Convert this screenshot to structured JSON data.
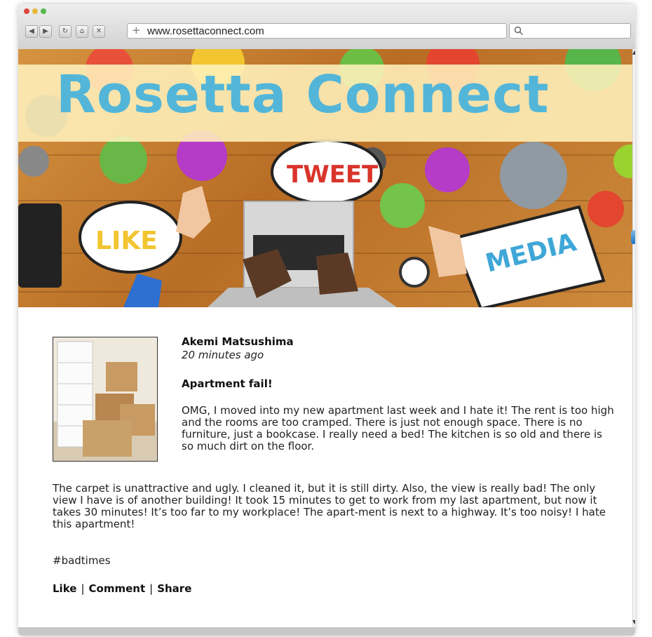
{
  "browser": {
    "url": "www.rosettaconnect.com",
    "search_icon": "magnifier-icon",
    "nav_icons": [
      "back-icon",
      "forward-icon",
      "reload-icon",
      "home-icon",
      "close-icon",
      "plus-icon"
    ]
  },
  "hero": {
    "site_title": "Rosetta Connect",
    "bubble_like": "LIKE",
    "bubble_tweet": "TWEET",
    "bubble_media": "MEDIA",
    "title_color": "#53b6d9"
  },
  "post": {
    "author": "Akemi Matsushima",
    "time": "20 minutes ago",
    "title": "Apartment fail!",
    "paragraph1": "OMG, I moved into my new apartment last week and I hate it! The rent is too high and the rooms are too cramped. There is just not enough space. There is no furniture, just a bookcase. I really need a bed! The kitchen is so old and there is so much dirt on the floor.",
    "paragraph2": "The carpet is unattractive and ugly. I cleaned it, but it is still dirty. Also, the view is really bad! The only view I have is of another building! It took 15 minutes to get to work from my last apartment, but now it takes 30 minutes! It’s too far to my workplace! The apart-ment is next to a highway. It’s too noisy! I hate this apartment!",
    "hashtag": "#badtimes",
    "actions": {
      "like": "Like",
      "comment": "Comment",
      "share": "Share",
      "separator": "|"
    }
  }
}
